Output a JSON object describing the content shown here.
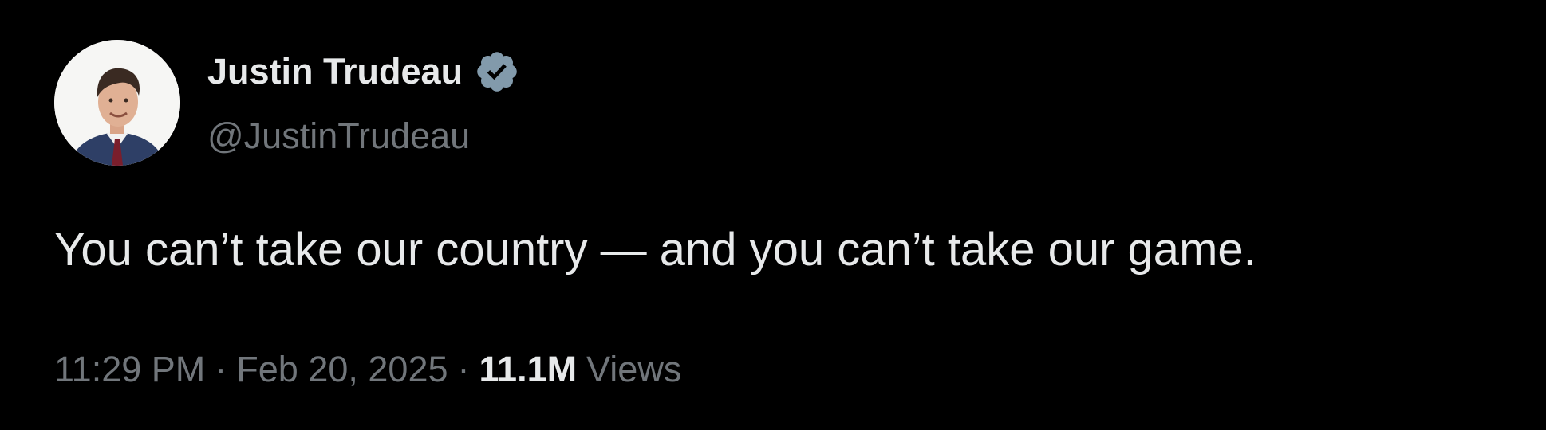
{
  "author": {
    "display_name": "Justin Trudeau",
    "handle": "@JustinTrudeau",
    "verified_icon": "verified-badge-icon",
    "avatar_icon": "profile-avatar"
  },
  "tweet": {
    "text": "You can’t take our country — and you can’t take our game."
  },
  "meta": {
    "time": "11:29 PM",
    "separator": "·",
    "date": "Feb 20, 2025",
    "views_count": "11.1M",
    "views_label": "Views"
  },
  "colors": {
    "background": "#000000",
    "primary_text": "#e7e9ea",
    "secondary_text": "#71767b",
    "verified_badge": "#829aab"
  }
}
